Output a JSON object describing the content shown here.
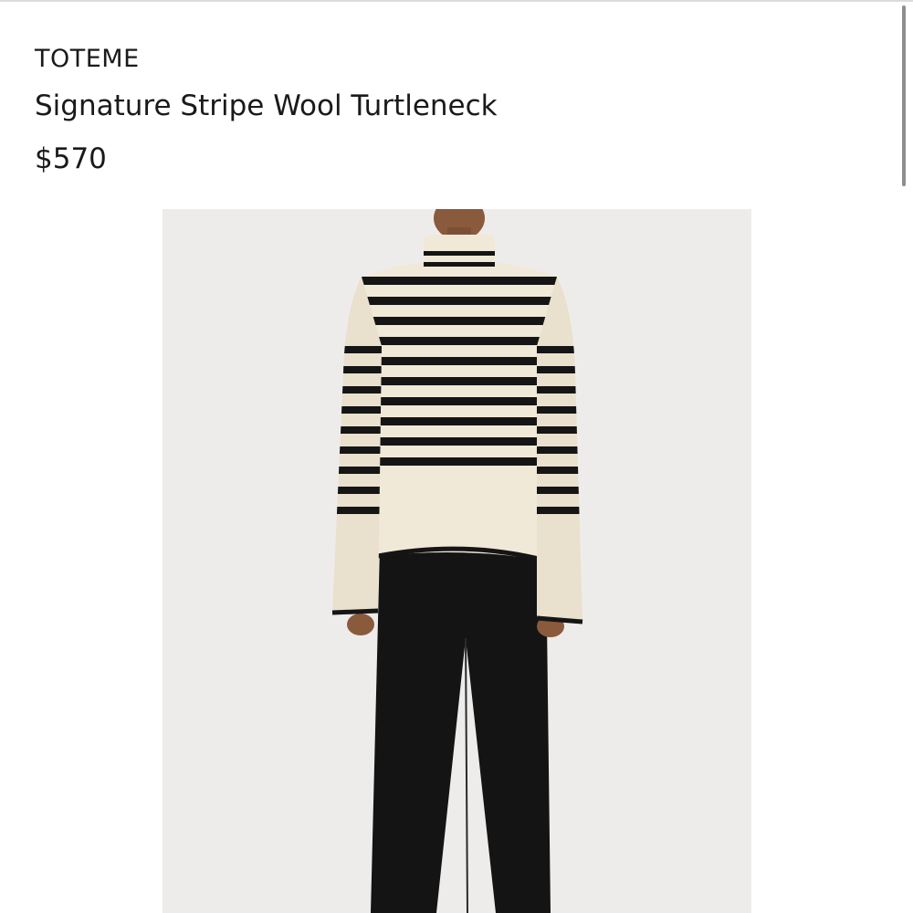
{
  "product": {
    "brand": "TOTEME",
    "title": "Signature Stripe Wool Turtleneck",
    "price": "$570"
  },
  "image": {
    "subject": "model-wearing-striped-turtleneck",
    "colors": {
      "background": "#eeeceb",
      "knit": "#f1e9d8",
      "stripe": "#151515",
      "trousers": "#141414",
      "skin": "#8a5a3c"
    }
  }
}
